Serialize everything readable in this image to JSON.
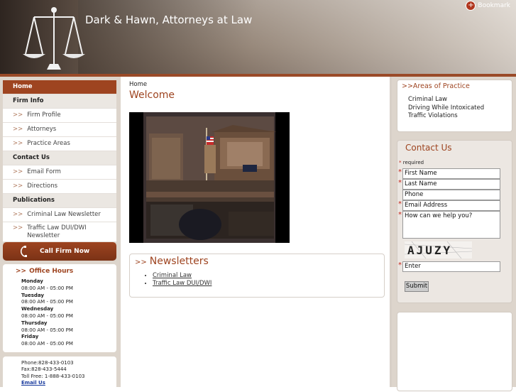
{
  "header": {
    "title": "Dark & Hawn, Attorneys at Law",
    "bookmark_label": "Bookmark"
  },
  "nav": {
    "items": [
      {
        "label": "Home",
        "kind": "active"
      },
      {
        "label": "Firm Info",
        "kind": "section"
      },
      {
        "label": "Firm Profile",
        "kind": "link"
      },
      {
        "label": "Attorneys",
        "kind": "link"
      },
      {
        "label": "Practice Areas",
        "kind": "link"
      },
      {
        "label": "Contact Us",
        "kind": "section"
      },
      {
        "label": "Email Form",
        "kind": "link"
      },
      {
        "label": "Directions",
        "kind": "link"
      },
      {
        "label": "Publications",
        "kind": "section"
      },
      {
        "label": "Criminal Law Newsletter",
        "kind": "link"
      },
      {
        "label": "Traffic Law DUI/DWI Newsletter",
        "kind": "link"
      }
    ],
    "arrow": ">>"
  },
  "call": {
    "label": "Call Firm Now"
  },
  "hours": {
    "title": "Office Hours",
    "days": [
      {
        "day": "Monday",
        "time": "08:00 AM - 05:00 PM"
      },
      {
        "day": "Tuesday",
        "time": "08:00 AM - 05:00 PM"
      },
      {
        "day": "Wednesday",
        "time": "08:00 AM - 05:00 PM"
      },
      {
        "day": "Thursday",
        "time": "08:00 AM - 05:00 PM"
      },
      {
        "day": "Friday",
        "time": "08:00 AM - 05:00 PM"
      }
    ]
  },
  "contact_info": {
    "phone": "Phone:828-433-0103",
    "fax": "Fax:828-433-5444",
    "tollfree": "Toll Free: 1-888-433-0103",
    "email_link": "Email Us"
  },
  "main": {
    "breadcrumb": "Home",
    "title": "Welcome",
    "newsletters": {
      "title": "Newsletters",
      "items": [
        "Criminal Law",
        "Traffic Law DUI/DWI"
      ]
    }
  },
  "practice": {
    "title": ">>Areas of Practice",
    "items": [
      "Criminal Law",
      "Driving While Intoxicated",
      "Traffic Violations"
    ]
  },
  "contact_form": {
    "title": "Contact Us",
    "required_note": "required",
    "first_name": "First Name",
    "last_name": "Last Name",
    "phone": "Phone",
    "email": "Email Address",
    "message": "How can we help you?",
    "captcha_text": "AJUZY",
    "captcha_input": "Enter",
    "submit": "Submit"
  },
  "colors": {
    "accent": "#9e4420",
    "link": "#1a3c9e",
    "panel": "#ddd5cc"
  }
}
